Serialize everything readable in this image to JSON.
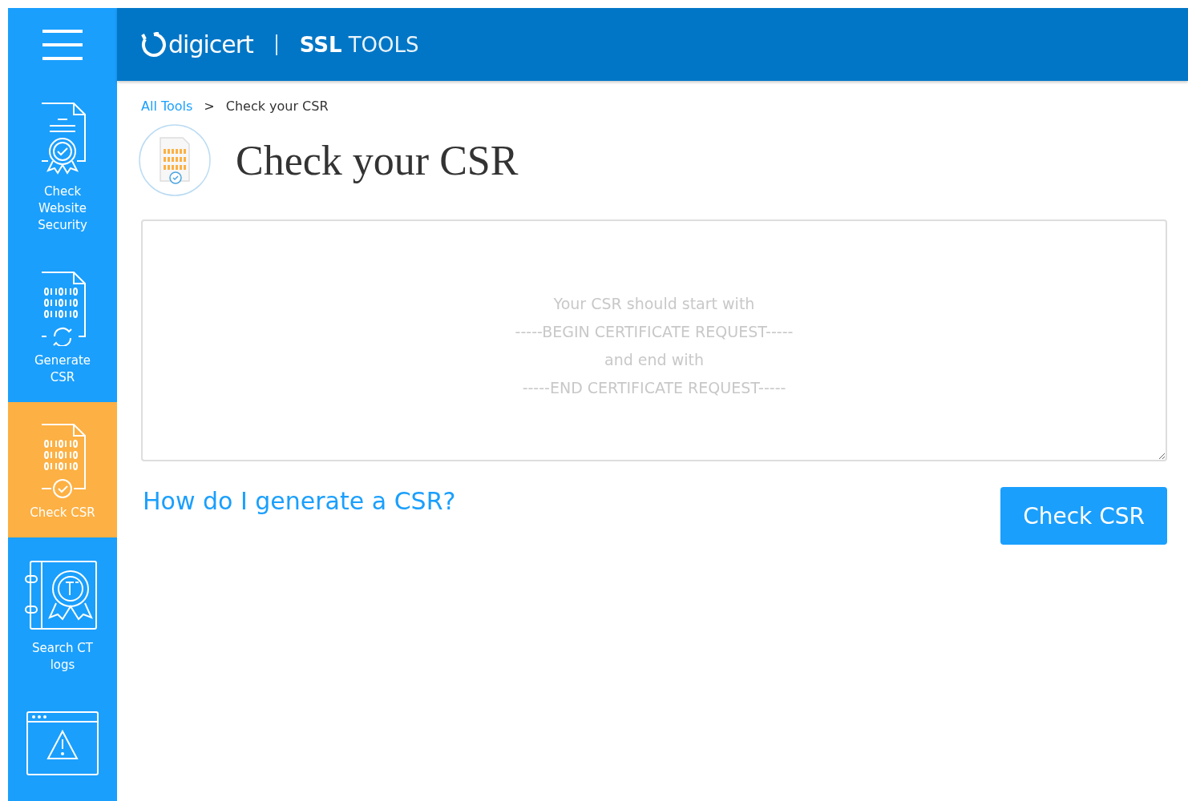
{
  "header": {
    "logo": "digicert",
    "product_bold": "SSL",
    "product_light": "TOOLS"
  },
  "sidebar": {
    "items": [
      {
        "kind": "certificate",
        "label": "Check Website Security",
        "selected": false
      },
      {
        "kind": "generate",
        "label": "Generate CSR",
        "selected": false
      },
      {
        "kind": "check",
        "label": "Check CSR",
        "selected": true
      },
      {
        "kind": "ct",
        "label": "Search CT logs",
        "selected": false
      },
      {
        "kind": "warning",
        "selected": false
      }
    ]
  },
  "breadcrumb": [
    {
      "label": "All Tools",
      "link": true
    },
    {
      "label": ">",
      "link": false
    },
    {
      "label": "Check your CSR",
      "link": false
    }
  ],
  "title": "Check your CSR",
  "csr_field": {
    "placeholder": "Your CSR should start with\n-----BEGIN CERTIFICATE REQUEST-----\nand end with\n-----END CERTIFICATE REQUEST-----"
  },
  "help_link": "How do I generate a CSR?",
  "submit_button": "Check CSR"
}
